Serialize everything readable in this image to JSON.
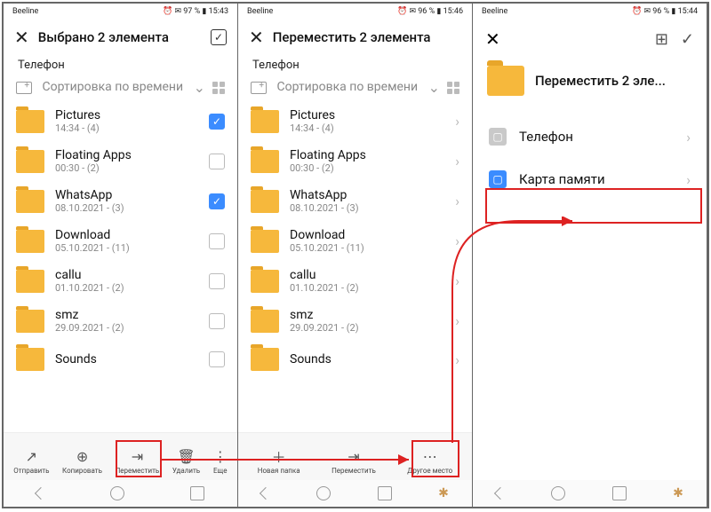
{
  "panel1": {
    "status": {
      "carrier": "Beeline",
      "right": "⏰ ✉ 97 % ▮ 15:43"
    },
    "title": "Выбрано 2 элемента",
    "location": "Телефон",
    "sort": "Сортировка по времени",
    "folders": [
      {
        "name": "Pictures",
        "meta": "14:34 - (4)",
        "checked": true
      },
      {
        "name": "Floating Apps",
        "meta": "00:30 - (2)",
        "checked": false
      },
      {
        "name": "WhatsApp",
        "meta": "08.10.2021 - (3)",
        "checked": true
      },
      {
        "name": "Download",
        "meta": "05.10.2021 - (11)",
        "checked": false
      },
      {
        "name": "callu",
        "meta": "01.10.2021 - (2)",
        "checked": false
      },
      {
        "name": "smz",
        "meta": "29.09.2021 - (2)",
        "checked": false
      },
      {
        "name": "Sounds",
        "meta": "",
        "checked": false
      }
    ],
    "actions": [
      "Отправить",
      "Копировать",
      "Переместить",
      "Удалить",
      "Еще"
    ]
  },
  "panel2": {
    "status": {
      "carrier": "Beeline",
      "right": "⏰ ✉ 96 % ▮ 15:46"
    },
    "title": "Переместить 2 элемента",
    "location": "Телефон",
    "sort": "Сортировка по времени",
    "folders": [
      {
        "name": "Pictures",
        "meta": "14:34 - (4)"
      },
      {
        "name": "Floating Apps",
        "meta": "00:30 - (2)"
      },
      {
        "name": "WhatsApp",
        "meta": "08.10.2021 - (3)"
      },
      {
        "name": "Download",
        "meta": "05.10.2021 - (11)"
      },
      {
        "name": "callu",
        "meta": "01.10.2021 - (2)"
      },
      {
        "name": "smz",
        "meta": "29.09.2021 - (2)"
      },
      {
        "name": "Sounds",
        "meta": ""
      }
    ],
    "actions": [
      "Новая папка",
      "Переместить",
      "Другое место"
    ]
  },
  "panel3": {
    "status": {
      "carrier": "Beeline",
      "right": "⏰ ✉ 96 % ▮ 15:44"
    },
    "moveTitle": "Переместить 2 эле...",
    "storages": [
      {
        "label": "Телефон",
        "icon": "phone-ic"
      },
      {
        "label": "Карта памяти",
        "icon": "sd-ic"
      }
    ]
  }
}
